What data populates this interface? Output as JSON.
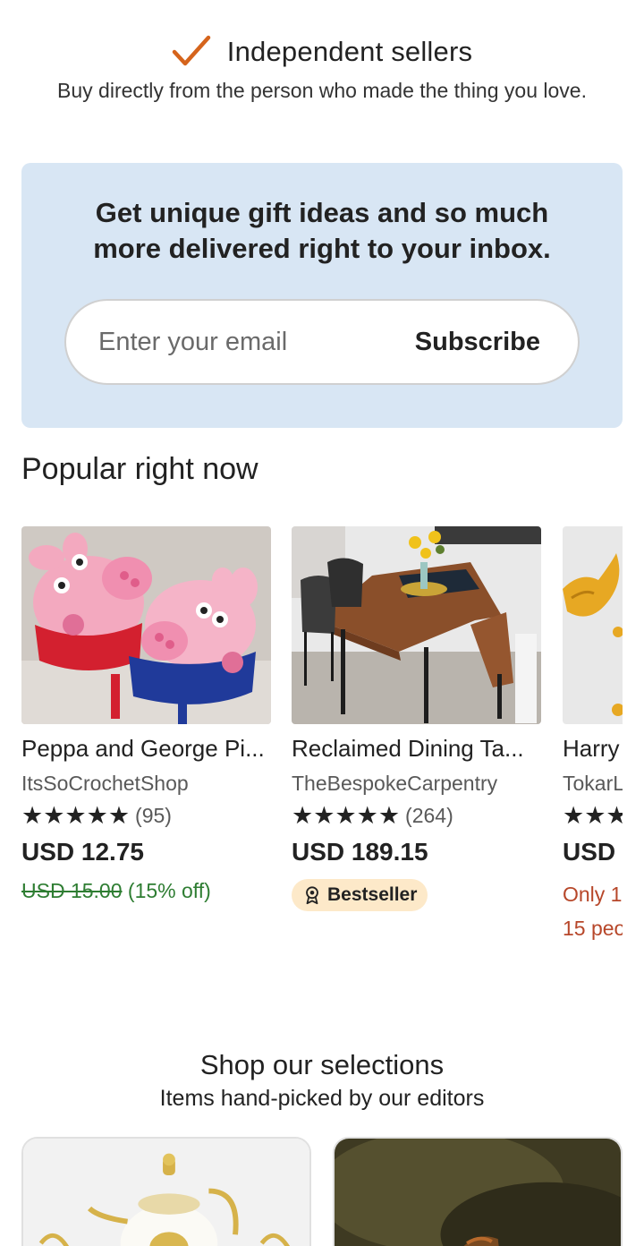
{
  "independent": {
    "icon": "checkmark-icon",
    "accent": "#d5641c",
    "title": "Independent sellers",
    "subtitle": "Buy directly from the person who made the thing you love."
  },
  "newsletter": {
    "title": "Get unique gift ideas and so much more delivered right to your inbox.",
    "email_placeholder": "Enter your email",
    "subscribe_label": "Subscribe",
    "background": "#d8e6f4"
  },
  "popular": {
    "title": "Popular right now",
    "items": [
      {
        "title": "Peppa and George Pi...",
        "shop": "ItsSoCrochetShop",
        "rating": 5,
        "stars": "★★★★★",
        "reviews": "(95)",
        "price": "USD 12.75",
        "original_price": "USD 15.00",
        "discount": "(15% off)"
      },
      {
        "title": "Reclaimed Dining Ta...",
        "shop": "TheBespokeCarpentry",
        "rating": 5,
        "stars": "★★★★★",
        "reviews": "(264)",
        "price": "USD 189.15",
        "badge": "Bestseller",
        "badge_icon": "award-icon"
      },
      {
        "title": "Harry",
        "shop": "TokarL",
        "stars": "★★★",
        "price": "USD",
        "stock_line1": "Only 1",
        "stock_line2": "15 peo"
      }
    ]
  },
  "selections": {
    "title": "Shop our selections",
    "subtitle": "Items hand-picked by our editors"
  }
}
